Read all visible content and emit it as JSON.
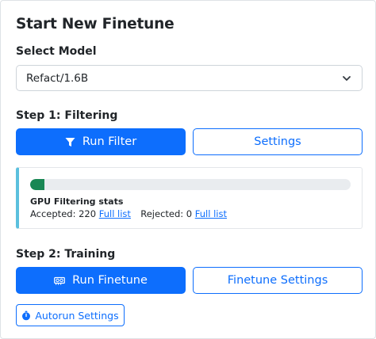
{
  "title": "Start New Finetune",
  "select_model": {
    "label": "Select Model",
    "value": "Refact/1.6B",
    "icon": "chevron-down-icon"
  },
  "step1": {
    "label": "Step 1: Filtering",
    "run_button": "Run Filter",
    "run_icon": "filter-icon",
    "settings_button": "Settings"
  },
  "stats": {
    "progress": 0.045,
    "progress_color": "#198754",
    "title": "GPU Filtering stats",
    "accepted_label": "Accepted: 220",
    "accepted_link": "Full list",
    "rejected_label": "Rejected: 0",
    "rejected_link": "Full list",
    "accent_color": "#5bc0de"
  },
  "step2": {
    "label": "Step 2: Training",
    "run_button": "Run Finetune",
    "run_icon": "gpu-card-icon",
    "settings_button": "Finetune Settings",
    "autorun_button": "Autorun Settings",
    "autorun_icon": "stopwatch-icon"
  },
  "colors": {
    "primary": "#0d6efd"
  }
}
